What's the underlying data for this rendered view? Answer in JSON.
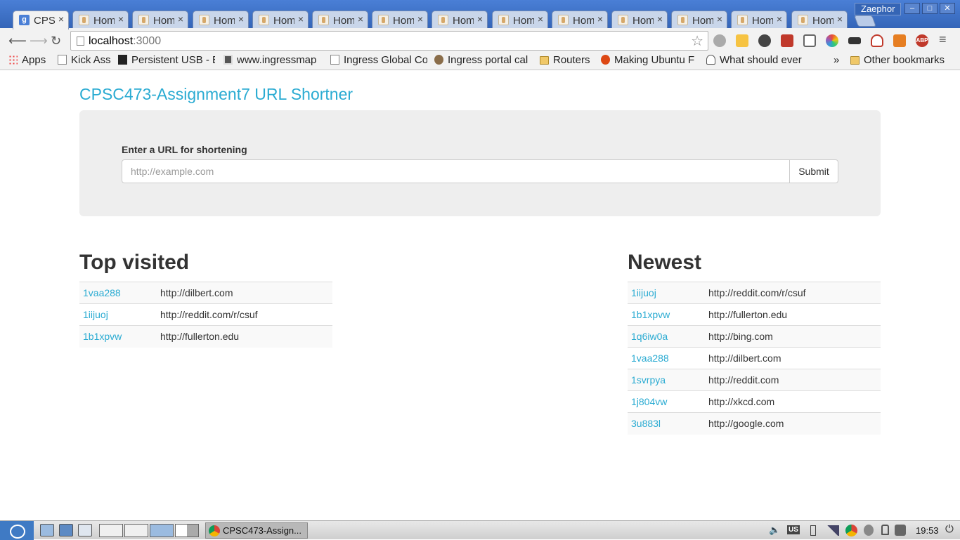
{
  "browser": {
    "tabs": [
      {
        "title": "CPSC",
        "active": true
      },
      {
        "title": "Hom",
        "active": false
      },
      {
        "title": "Hom",
        "active": false
      },
      {
        "title": "Hom",
        "active": false
      },
      {
        "title": "Hom",
        "active": false
      },
      {
        "title": "Hom",
        "active": false
      },
      {
        "title": "Hom",
        "active": false
      },
      {
        "title": "Hom",
        "active": false
      },
      {
        "title": "Hom",
        "active": false
      },
      {
        "title": "Hom",
        "active": false
      },
      {
        "title": "Hom",
        "active": false
      },
      {
        "title": "Hom",
        "active": false
      },
      {
        "title": "Hom",
        "active": false
      },
      {
        "title": "Hom",
        "active": false
      }
    ],
    "profile_name": "Zaephor",
    "url_host": "localhost",
    "url_port": ":3000",
    "bookmarks": [
      {
        "label": "Apps",
        "icon": "apps-grid-icon"
      },
      {
        "label": "Kick Ass",
        "icon": "document-icon"
      },
      {
        "label": "Persistent USB - E",
        "icon": "dark-site-icon"
      },
      {
        "label": "www.ingressmap",
        "icon": "gray-site-icon"
      },
      {
        "label": "Ingress Global Co",
        "icon": "document-icon"
      },
      {
        "label": "Ingress portal cal",
        "icon": "gear-site-icon"
      },
      {
        "label": "Routers",
        "icon": "folder-icon"
      },
      {
        "label": "Making Ubuntu F",
        "icon": "ubuntu-icon"
      },
      {
        "label": "What should ever",
        "icon": "ghost-site-icon"
      }
    ],
    "bookmarks_overflow": "»",
    "other_bookmarks": "Other bookmarks"
  },
  "page": {
    "title": "CPSC473-Assignment7 URL Shortner",
    "form": {
      "label": "Enter a URL for shortening",
      "placeholder": "http://example.com",
      "value": "",
      "submit_label": "Submit"
    },
    "top_visited": {
      "heading": "Top visited",
      "rows": [
        {
          "code": "1vaa288",
          "url": "http://dilbert.com"
        },
        {
          "code": "1iijuoj",
          "url": "http://reddit.com/r/csuf"
        },
        {
          "code": "1b1xpvw",
          "url": "http://fullerton.edu"
        }
      ]
    },
    "newest": {
      "heading": "Newest",
      "rows": [
        {
          "code": "1iijuoj",
          "url": "http://reddit.com/r/csuf"
        },
        {
          "code": "1b1xpvw",
          "url": "http://fullerton.edu"
        },
        {
          "code": "1q6iw0a",
          "url": "http://bing.com"
        },
        {
          "code": "1vaa288",
          "url": "http://dilbert.com"
        },
        {
          "code": "1svrpya",
          "url": "http://reddit.com"
        },
        {
          "code": "1j804vw",
          "url": "http://xkcd.com"
        },
        {
          "code": "3u883l",
          "url": "http://google.com"
        }
      ]
    },
    "link_color": "#2aabd2"
  },
  "taskbar": {
    "task_label": "CPSC473-Assign...",
    "keyboard_layout": "US",
    "clock": "19:53"
  }
}
